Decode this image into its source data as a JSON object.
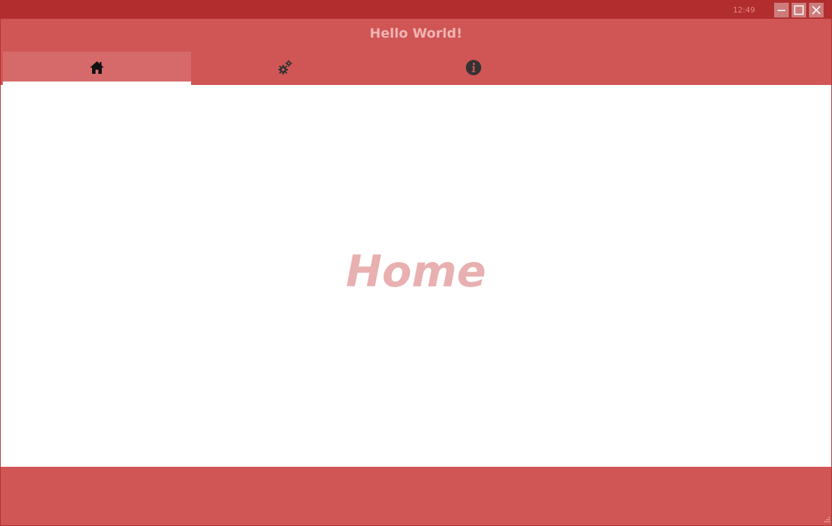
{
  "titlebar": {
    "clock": "12:49",
    "buttons": {
      "minimize_icon": "minimize-icon",
      "maximize_icon": "maximize-icon",
      "close_icon": "close-icon"
    }
  },
  "header": {
    "title": "Hello World!"
  },
  "tabs": [
    {
      "id": "home",
      "icon": "home-icon",
      "active": true
    },
    {
      "id": "settings",
      "icon": "gears-icon",
      "active": false
    },
    {
      "id": "info",
      "icon": "info-icon",
      "active": false
    }
  ],
  "main": {
    "heading": "Home"
  },
  "colors": {
    "titlebar": "#b22e2e",
    "header": "#d05555",
    "active_tab": "#d66a6a",
    "title_text": "#f0b4b4",
    "heading_text": "#e8b0b0",
    "footer": "#d05555"
  }
}
